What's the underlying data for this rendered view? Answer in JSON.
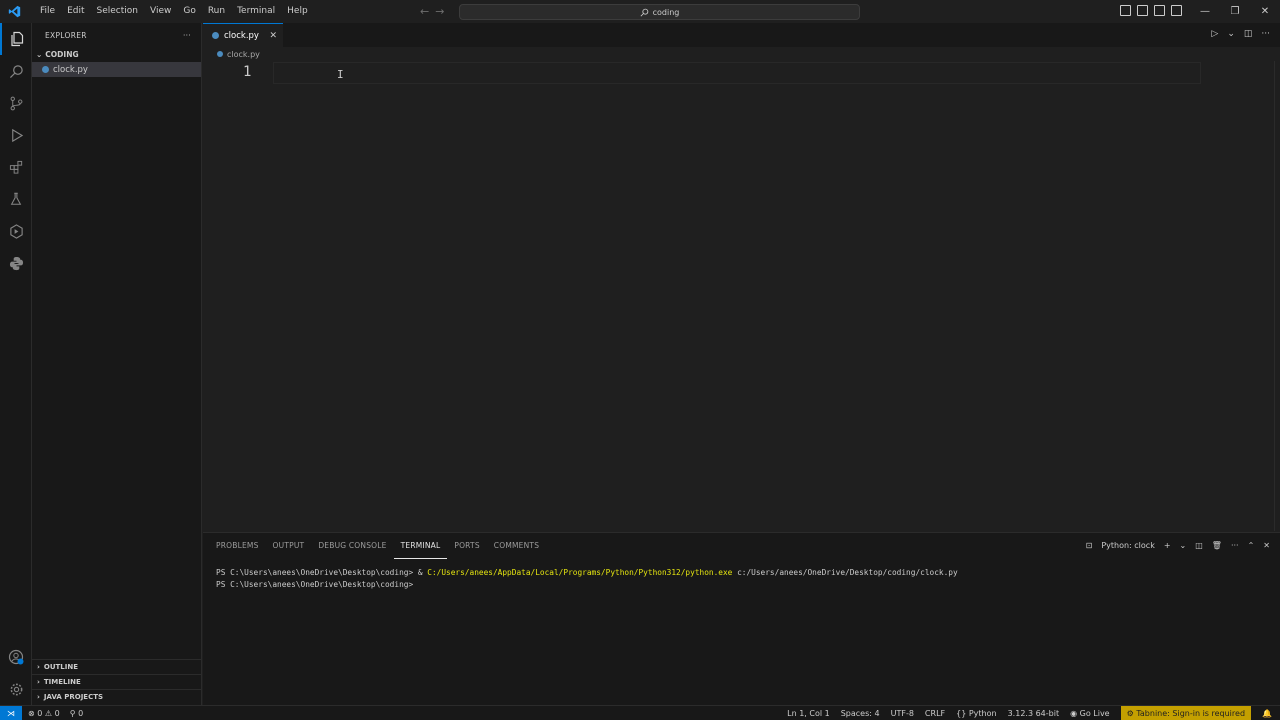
{
  "menu": [
    "File",
    "Edit",
    "Selection",
    "View",
    "Go",
    "Run",
    "Terminal",
    "Help"
  ],
  "search": {
    "text": "coding"
  },
  "sidebar": {
    "title": "EXPLORER",
    "folder": "CODING",
    "files": [
      "clock.py"
    ],
    "sections": [
      "OUTLINE",
      "TIMELINE",
      "JAVA PROJECTS"
    ]
  },
  "editor": {
    "tab_label": "clock.py",
    "breadcrumb": "clock.py",
    "line_number": "1"
  },
  "panel": {
    "tabs": [
      "PROBLEMS",
      "OUTPUT",
      "DEBUG CONSOLE",
      "TERMINAL",
      "PORTS",
      "COMMENTS"
    ],
    "active_tab": "TERMINAL",
    "terminal_name": "Python: clock",
    "line1_prompt": "PS C:\\Users\\anees\\OneDrive\\Desktop\\coding> & ",
    "line1_exe": "C:/Users/anees/AppData/Local/Programs/Python/Python312/python.exe",
    "line1_arg": " c:/Users/anees/OneDrive/Desktop/coding/clock.py",
    "line2_prompt": "PS C:\\Users\\anees\\OneDrive\\Desktop\\coding>"
  },
  "status": {
    "errors": "0",
    "warnings": "0",
    "ports": "0",
    "position": "Ln 1, Col 1",
    "spaces": "Spaces: 4",
    "encoding": "UTF-8",
    "eol": "CRLF",
    "language": "Python",
    "interpreter": "3.12.3 64-bit",
    "golive": "Go Live",
    "tabnine": "Tabnine: Sign-in is required"
  },
  "colors": {
    "accent": "#0078d4",
    "tabnine_bg": "#c4a000",
    "terminal_path": "#e5e510"
  }
}
